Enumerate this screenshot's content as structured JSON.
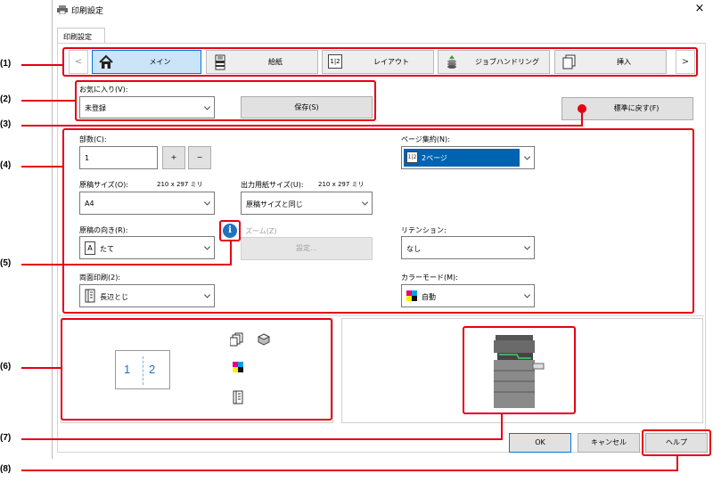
{
  "window": {
    "title": "印刷設定",
    "close_glyph": "×"
  },
  "tab_header": "印刷設定",
  "tabs": [
    {
      "label": "メイン",
      "icon": "home-icon"
    },
    {
      "label": "給紙",
      "icon": "paper-tray-icon"
    },
    {
      "label": "レイアウト",
      "icon": "layout-icon",
      "icon_text": "1|2"
    },
    {
      "label": "ジョブハンドリング",
      "icon": "job-handling-icon"
    },
    {
      "label": "挿入",
      "icon": "insert-icon"
    }
  ],
  "nav": {
    "prev": "<",
    "next": ">"
  },
  "favorites": {
    "label": "お気に入り(V):",
    "value": "未登録",
    "save_button": "保存(S)"
  },
  "restore_defaults_button": "標準に戻す(F)",
  "copies": {
    "label": "部数(C):",
    "value": "1",
    "plus": "+",
    "minus": "−"
  },
  "original_size": {
    "label": "原稿サイズ(O):",
    "dims": "210 x 297 ミリ",
    "value": "A4"
  },
  "output_size": {
    "label": "出力用紙サイズ(U):",
    "dims": "210 x 297 ミリ",
    "value": "原稿サイズと同じ"
  },
  "orientation": {
    "label": "原稿の向き(R):",
    "value": "たて",
    "icon_text": "A"
  },
  "zoom": {
    "label": "ズーム(Z)",
    "button": "設定..."
  },
  "duplex": {
    "label": "両面印刷(2):",
    "value": "長辺とじ"
  },
  "nup": {
    "label": "ページ集約(N):",
    "value": "2ページ",
    "icon_text": "1|2"
  },
  "retention": {
    "label": "リテンション:",
    "value": "なし"
  },
  "color_mode": {
    "label": "カラーモード(M):",
    "value": "自動"
  },
  "preview": {
    "page_left": "1",
    "page_right": "2"
  },
  "footer": {
    "ok": "OK",
    "cancel": "キャンセル",
    "help": "ヘルプ"
  },
  "callouts": [
    "(1)",
    "(2)",
    "(3)",
    "(4)",
    "(5)",
    "(6)",
    "(7)",
    "(8)"
  ],
  "colors": {
    "selected_tab": "#cce4f7",
    "selected_tab_border": "#0078d7",
    "highlight": "#0063b1",
    "callout": "#e60012",
    "info": "#1e73be"
  }
}
